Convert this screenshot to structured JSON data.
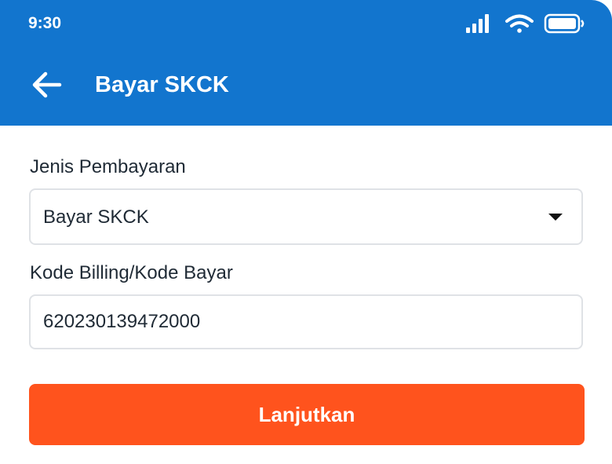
{
  "status_bar": {
    "time": "9:30",
    "icons": [
      "cellular-signal-icon",
      "wifi-icon",
      "battery-icon"
    ]
  },
  "app_bar": {
    "back_icon": "back-arrow-icon",
    "title": "Bayar SKCK"
  },
  "form": {
    "payment_type": {
      "label": "Jenis Pembayaran",
      "selected_value": "Bayar SKCK",
      "icon": "dropdown-caret-icon"
    },
    "billing_code": {
      "label": "Kode Billing/Kode Bayar",
      "value": "620230139472000"
    },
    "submit_label": "Lanjutkan"
  },
  "colors": {
    "header": "#1275CE",
    "primary_button": "#FF531D",
    "text": "#1f2a35",
    "field_border": "#dfe2e6"
  }
}
